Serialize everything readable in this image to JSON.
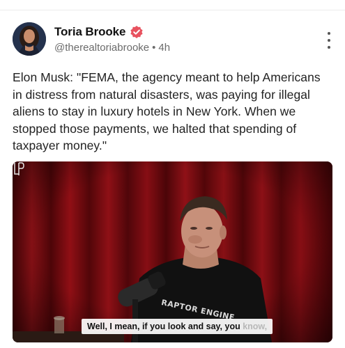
{
  "post": {
    "author": {
      "display_name": "Toria Brooke",
      "handle": "@therealtoriabrooke",
      "separator": "•",
      "time_ago": "4h",
      "verified_color": "#e8525f"
    },
    "text": "Elon Musk: \"FEMA, the agency meant to help Americans in distress from natural disasters, was paying for illegal aliens to stay in luxury hotels in New York. When we stopped those payments, we halted that spending of taxpayer money.\"",
    "media": {
      "caption_main": "Well, I mean, if you look and say, you ",
      "caption_faded": "know,",
      "shirt_text": "RAPTOR ENGINE",
      "watermark": "LP"
    }
  },
  "colors": {
    "curtain": "#7a0b10",
    "text_primary": "#222222",
    "text_secondary": "#6b6b6b"
  },
  "icons": {
    "verified": "verified-badge-icon",
    "more": "more-vertical-icon",
    "watermark": "watermark-logo-icon"
  }
}
